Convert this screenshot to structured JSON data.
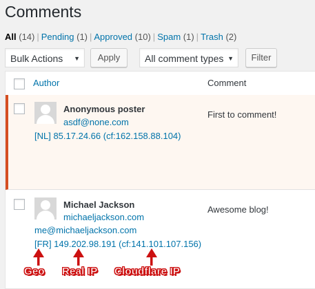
{
  "page": {
    "title": "Comments"
  },
  "filters": [
    {
      "label": "All",
      "count": "(14)",
      "current": true
    },
    {
      "label": "Pending",
      "count": "(1)",
      "current": false
    },
    {
      "label": "Approved",
      "count": "(10)",
      "current": false
    },
    {
      "label": "Spam",
      "count": "(1)",
      "current": false
    },
    {
      "label": "Trash",
      "count": "(2)",
      "current": false
    }
  ],
  "filter_separator": "|",
  "toolbar": {
    "bulk_actions": "Bulk Actions",
    "apply_label": "Apply",
    "comment_types": "All comment types",
    "filter_label": "Filter",
    "caret": "▼"
  },
  "table": {
    "columns": {
      "author": "Author",
      "comment": "Comment"
    },
    "rows": [
      {
        "author_name": "Anonymous poster",
        "author_email": "asdf@none.com",
        "author_ip": "[NL] 85.17.24.66 (cf:162.158.88.104)",
        "comment": "First to comment!",
        "status": "pending"
      },
      {
        "author_name": "Michael Jackson",
        "author_url": "michaeljackson.com",
        "author_email": "me@michaeljackson.com",
        "author_ip": "[FR] 149.202.98.191 (cf:141.101.107.156)",
        "comment": "Awesome blog!",
        "status": "approved"
      }
    ]
  },
  "annotations": {
    "geo": "Geo",
    "real_ip": "Real IP",
    "cloudflare_ip": "Cloudflare IP",
    "color": "#cc1111"
  },
  "colors": {
    "link": "#0073aa",
    "pending_border": "#d54e21",
    "pending_bg": "#fef7f1",
    "page_bg": "#f1f1f1"
  },
  "icons": {
    "avatar": "avatar-icon",
    "dropdown": "chevron-down-icon",
    "arrow": "arrow-up-icon"
  }
}
